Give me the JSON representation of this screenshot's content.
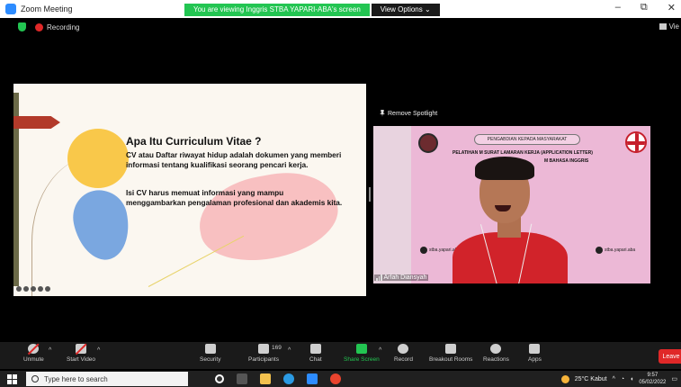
{
  "titlebar": {
    "app_title": "Zoom Meeting",
    "share_banner": "You are viewing Inggris STBA YAPARI-ABA's screen",
    "view_options": "View Options ⌄",
    "minimize": "–",
    "maximize": "⧉",
    "close": "✕"
  },
  "status": {
    "recording_label": "Recording",
    "view_label": "Vie"
  },
  "slide": {
    "title": "Apa Itu Curriculum Vitae ?",
    "paragraph1": "CV atau Daftar riwayat hidup adalah dokumen yang memberi informasi tentang kualifikasi seorang pencari kerja.",
    "paragraph2": "Isi CV harus memuat informasi yang mampu menggambarkan pengalaman profesional dan akademis kita."
  },
  "spotlight": {
    "remove_label": "Remove Spotlight",
    "banner_top": "PENGABDIAN KEPADA MASYARAKAT",
    "banner_line1": "PELATIHAN M         SURAT LAMARAN KERJA (APPLICATION LETTER)",
    "banner_line2": "M BAHASA INGGRIS",
    "ig_handle": "stba.yapari.aba",
    "fb_handle": "stba.yapari.aba",
    "participant_name": "Arfah Diansyah"
  },
  "toolbar": {
    "unmute": "Unmute",
    "start_video": "Start Video",
    "security": "Security",
    "participants": "Participants",
    "participant_count": "169",
    "chat": "Chat",
    "share_screen": "Share Screen",
    "record": "Record",
    "breakout_rooms": "Breakout Rooms",
    "reactions": "Reactions",
    "apps": "Apps",
    "leave": "Leave"
  },
  "taskbar": {
    "search_placeholder": "Type here to search",
    "weather": "25°C  Kabut",
    "time": "9:57",
    "date": "05/02/2022"
  },
  "colors": {
    "zoom_green": "#23c552",
    "record_red": "#e02828",
    "leave_red": "#e02828",
    "shirt_red": "#d1232a",
    "banner_pink": "#ecb8d6"
  }
}
